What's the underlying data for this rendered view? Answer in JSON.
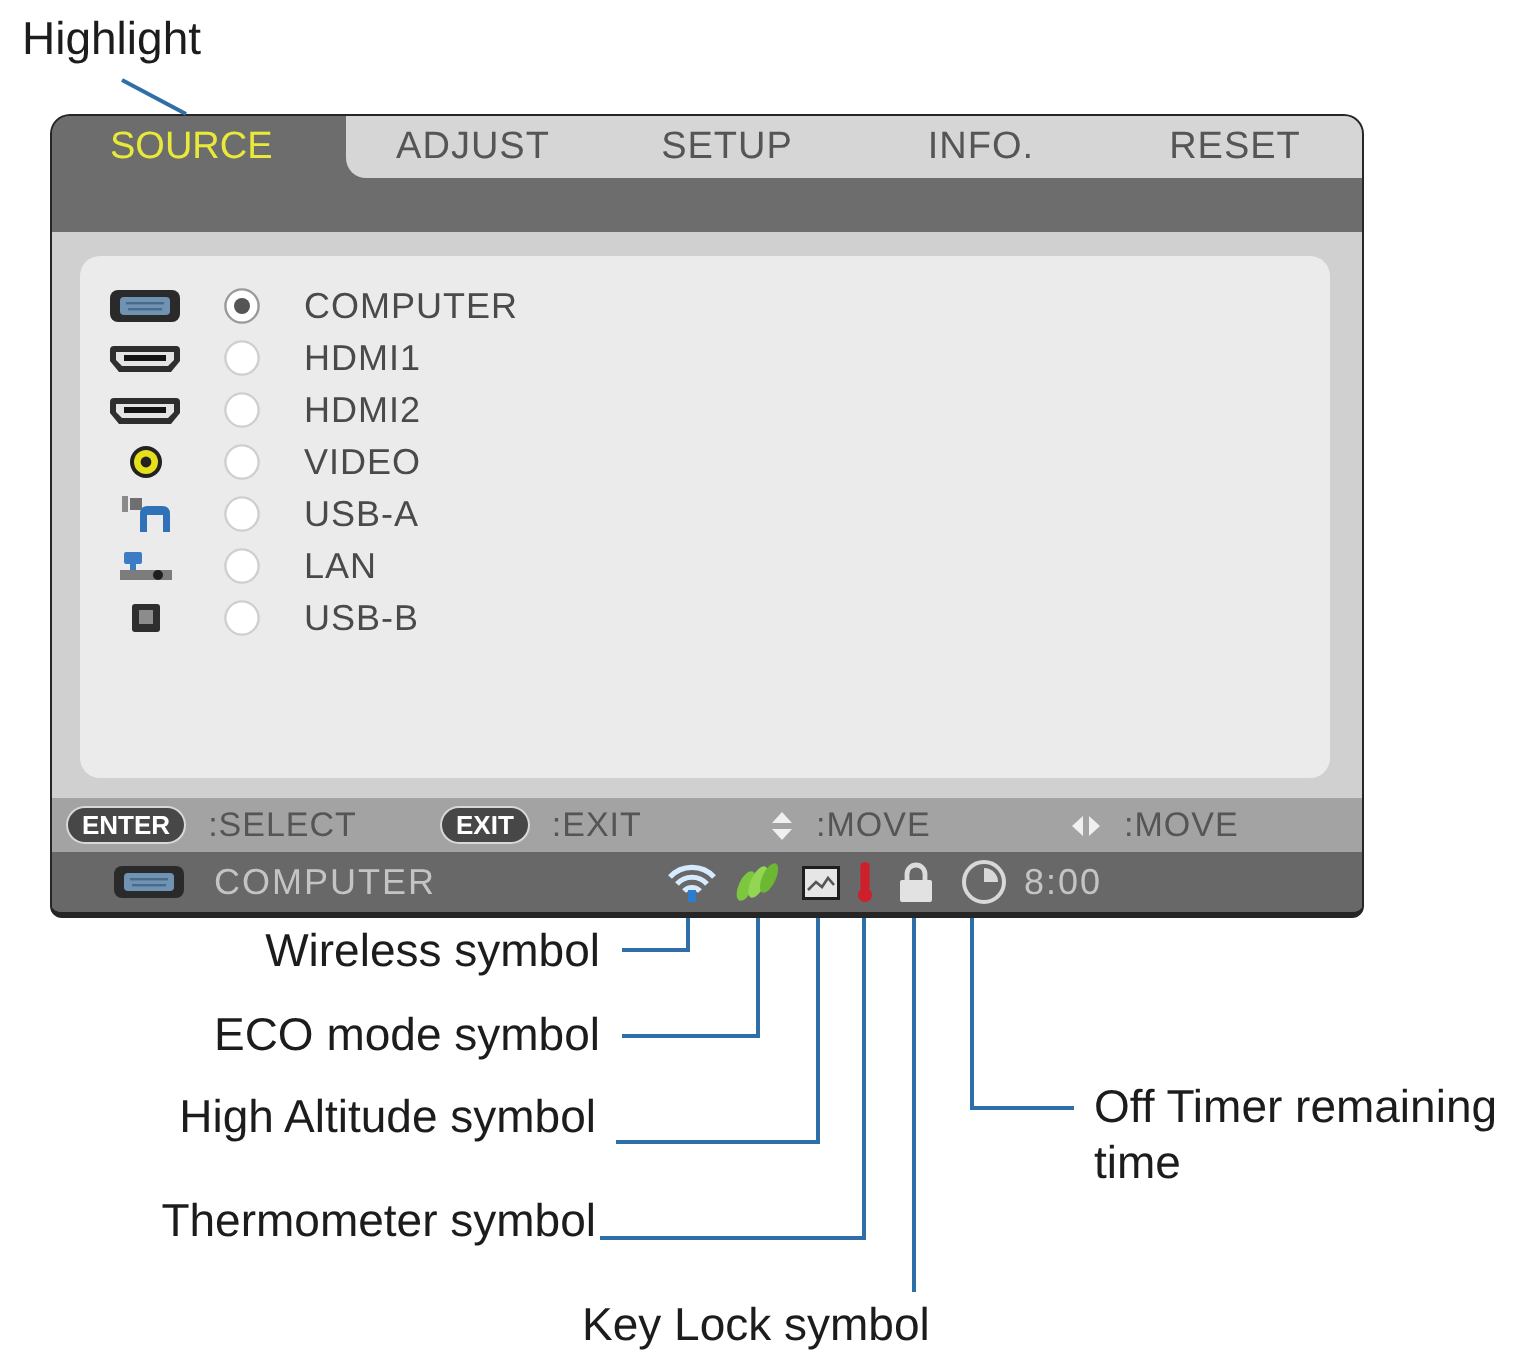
{
  "annotation": {
    "label": "Highlight"
  },
  "tabs": [
    {
      "label": "SOURCE",
      "selected": true
    },
    {
      "label": "ADJUST",
      "selected": false
    },
    {
      "label": "SETUP",
      "selected": false
    },
    {
      "label": "INFO.",
      "selected": false
    },
    {
      "label": "RESET",
      "selected": false
    }
  ],
  "sources": [
    {
      "kind": "vga",
      "label": "COMPUTER",
      "selected": true
    },
    {
      "kind": "hdmi",
      "label": "HDMI1",
      "selected": false
    },
    {
      "kind": "hdmi",
      "label": "HDMI2",
      "selected": false
    },
    {
      "kind": "rca",
      "label": "VIDEO",
      "selected": false
    },
    {
      "kind": "usb_a",
      "label": "USB-A",
      "selected": false
    },
    {
      "kind": "lan",
      "label": "LAN",
      "selected": false
    },
    {
      "kind": "usb_b",
      "label": "USB-B",
      "selected": false
    }
  ],
  "key_guide": [
    {
      "kind": "key",
      "key": "ENTER",
      "action": ":SELECT"
    },
    {
      "kind": "key",
      "key": "EXIT",
      "action": ":EXIT"
    },
    {
      "kind": "updown",
      "action": ":MOVE"
    },
    {
      "kind": "leftright",
      "action": ":MOVE"
    }
  ],
  "status_bar": {
    "input": {
      "kind": "vga",
      "label": "COMPUTER"
    },
    "timer": "8:00"
  },
  "callouts": [
    {
      "label": "Wireless symbol"
    },
    {
      "label": "ECO mode symbol"
    },
    {
      "label": "High Altitude symbol"
    },
    {
      "label": "Thermometer symbol"
    },
    {
      "label": "Key Lock symbol"
    },
    {
      "label": "Off Timer remaining time"
    }
  ]
}
